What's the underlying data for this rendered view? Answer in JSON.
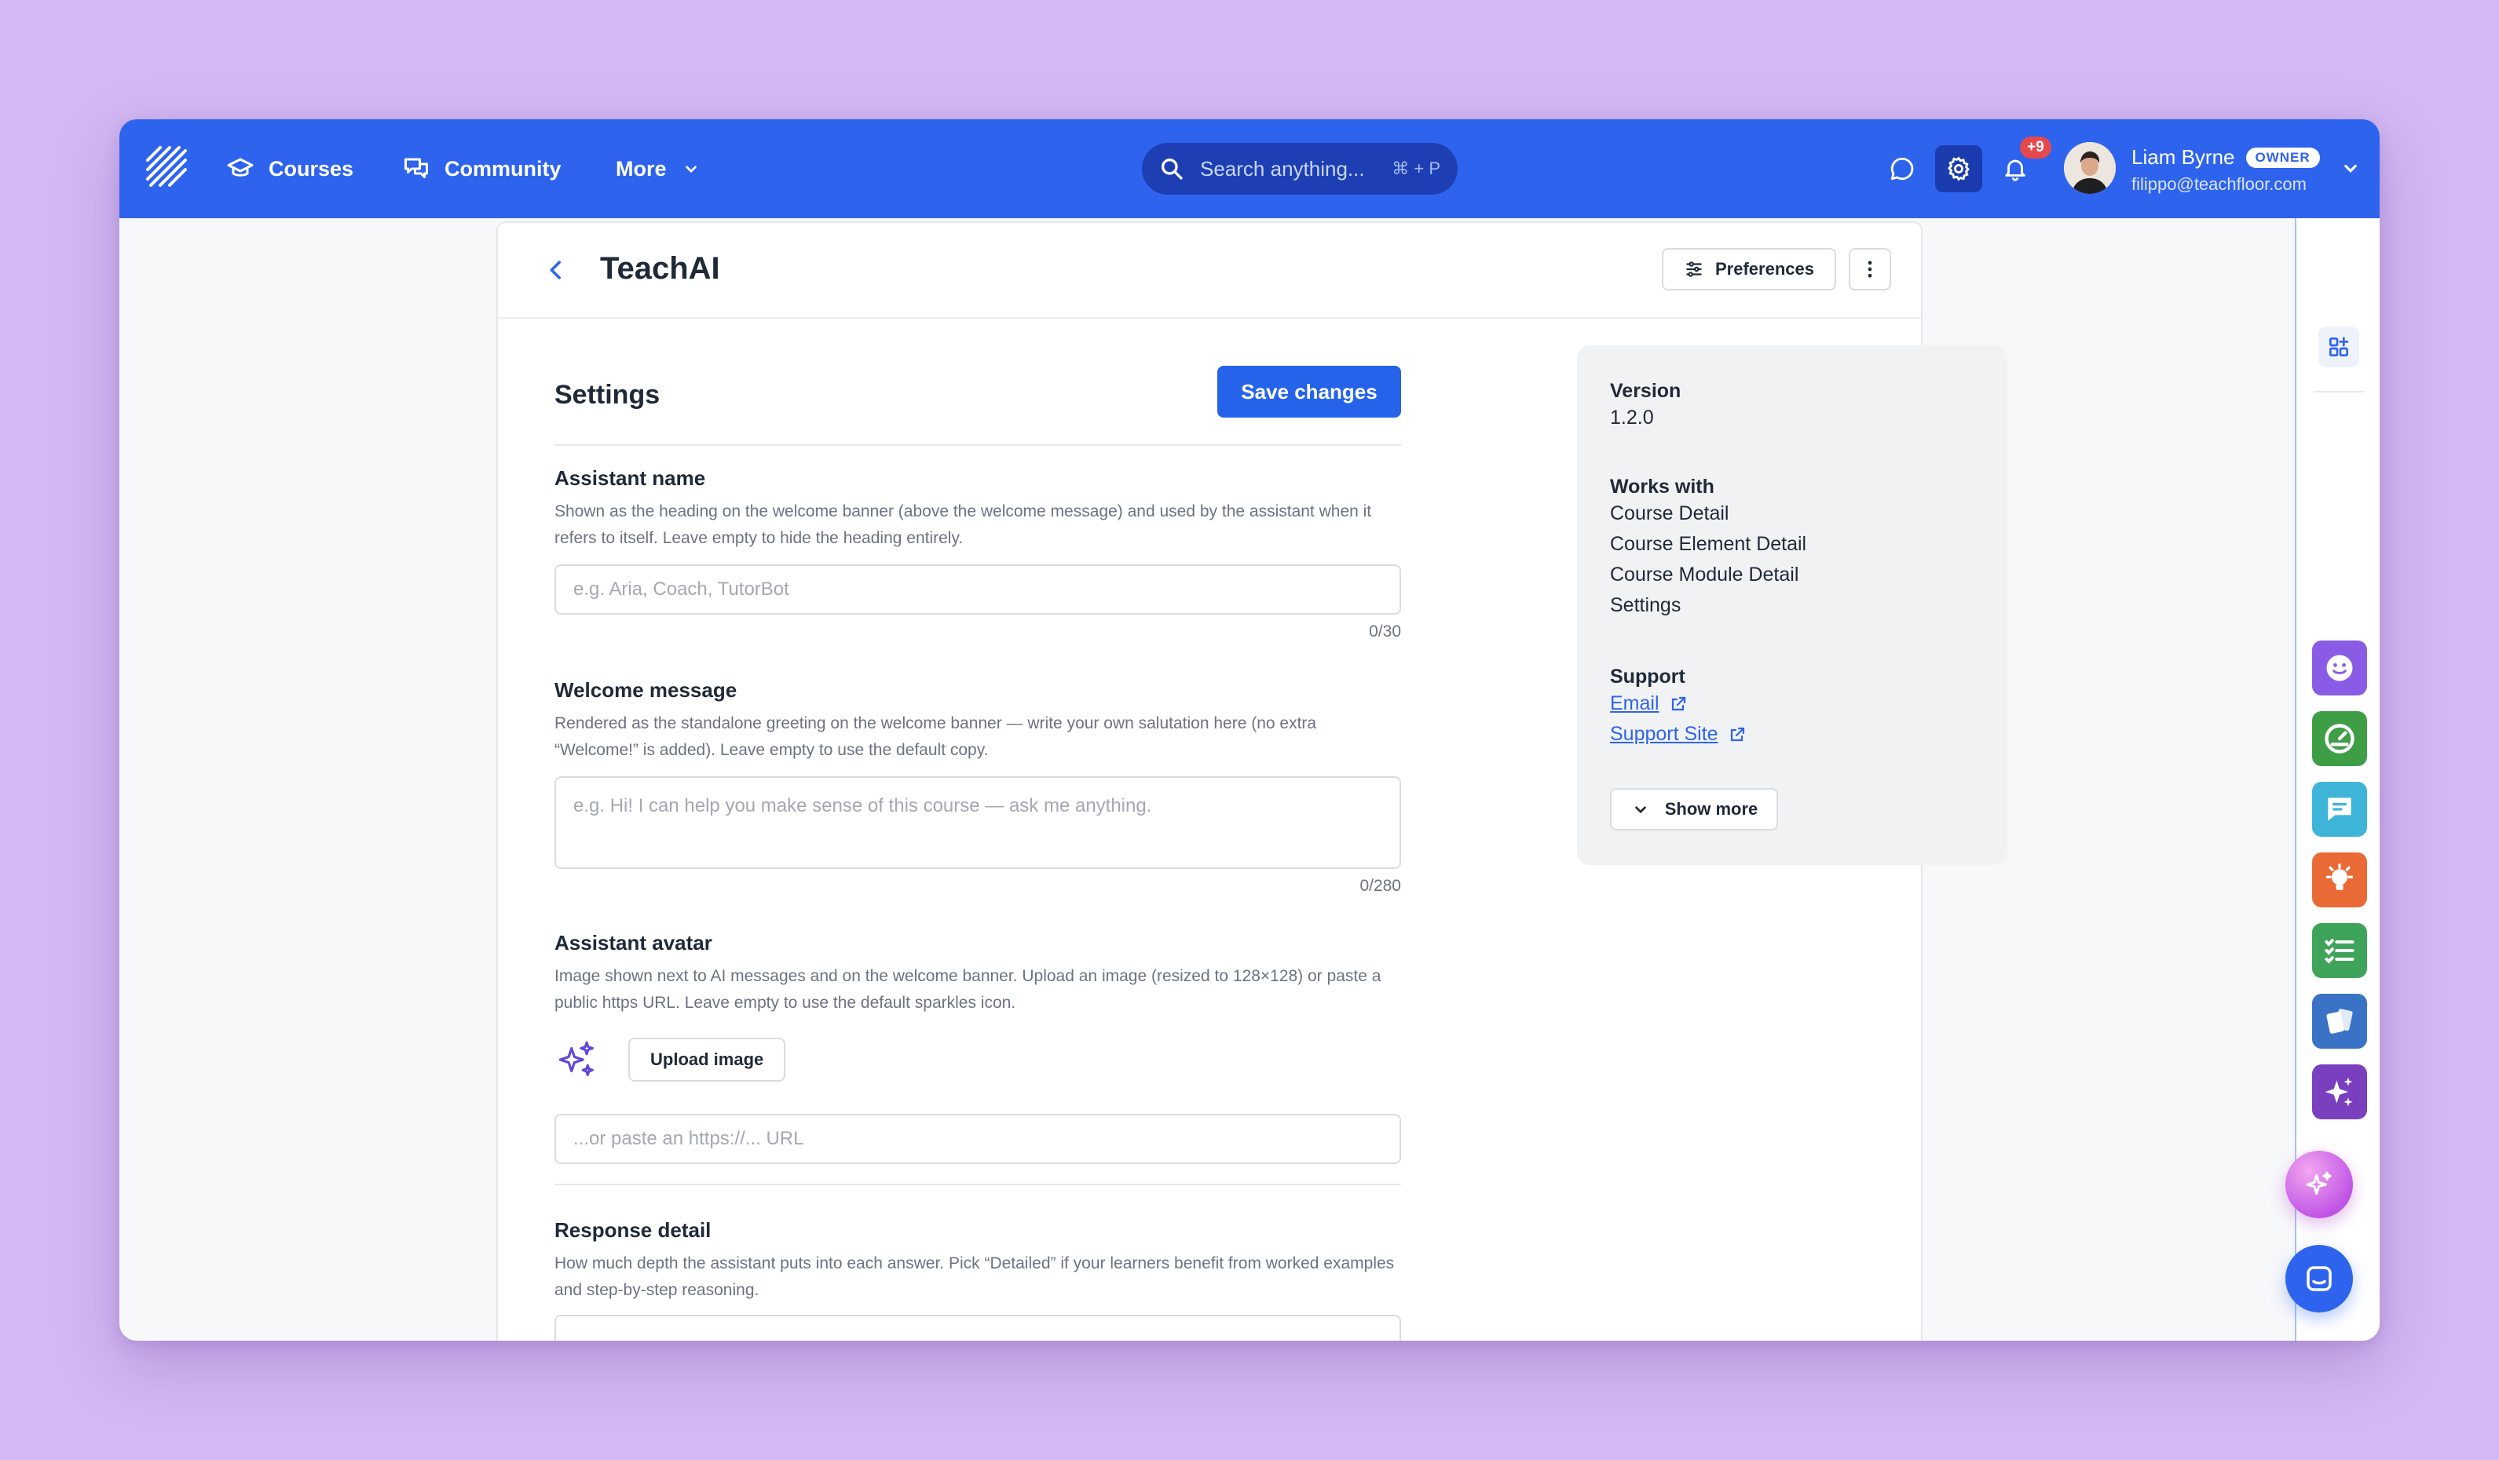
{
  "topbar": {
    "nav": [
      {
        "label": "Courses",
        "icon": "graduation-cap-icon"
      },
      {
        "label": "Community",
        "icon": "chat-bubbles-icon"
      },
      {
        "label": "More",
        "icon": "chevron-down-icon"
      }
    ],
    "search_placeholder": "Search anything...",
    "search_shortcut": "⌘ + P",
    "notification_badge": "+9",
    "user": {
      "name": "Liam Byrne",
      "role_badge": "OWNER",
      "email": "filippo@teachfloor.com"
    }
  },
  "page": {
    "title": "TeachAI",
    "preferences_label": "Preferences"
  },
  "settings": {
    "title": "Settings",
    "save_label": "Save changes",
    "assistant_name": {
      "label": "Assistant name",
      "help": "Shown as the heading on the welcome banner (above the welcome message) and used by the assistant when it refers to itself. Leave empty to hide the heading entirely.",
      "placeholder": "e.g. Aria, Coach, TutorBot",
      "counter": "0/30"
    },
    "welcome_message": {
      "label": "Welcome message",
      "help": "Rendered as the standalone greeting on the welcome banner — write your own salutation here (no extra “Welcome!” is added). Leave empty to use the default copy.",
      "placeholder": "e.g. Hi! I can help you make sense of this course — ask me anything.",
      "counter": "0/280"
    },
    "assistant_avatar": {
      "label": "Assistant avatar",
      "help": "Image shown next to AI messages and on the welcome banner. Upload an image (resized to 128×128) or paste a public https URL. Leave empty to use the default sparkles icon.",
      "upload_label": "Upload image",
      "url_placeholder": "...or paste an https://... URL"
    },
    "response_detail": {
      "label": "Response detail",
      "help": "How much depth the assistant puts into each answer. Pick “Detailed” if your learners benefit from worked examples and step-by-step reasoning."
    }
  },
  "info": {
    "version_label": "Version",
    "version": "1.2.0",
    "works_with_label": "Works with",
    "works_with": [
      "Course Detail",
      "Course Element Detail",
      "Course Module Detail",
      "Settings"
    ],
    "support_label": "Support",
    "support_links": [
      "Email",
      "Support Site"
    ],
    "show_more_label": "Show more"
  },
  "rail_apps": [
    {
      "name": "smiley-app",
      "color": "#8a5ce6"
    },
    {
      "name": "gauge-app",
      "color": "#3e9e46"
    },
    {
      "name": "chat-app",
      "color": "#3fb4d9"
    },
    {
      "name": "lightbulb-app",
      "color": "#ea6a35"
    },
    {
      "name": "checklist-app",
      "color": "#3ea45a"
    },
    {
      "name": "cards-app",
      "color": "#3a73c6"
    },
    {
      "name": "sparkle-app",
      "color": "#7a3fbf"
    }
  ],
  "colors": {
    "brand": "#2e63ee",
    "primary_button": "#2563eb",
    "notification": "#e5484d"
  }
}
